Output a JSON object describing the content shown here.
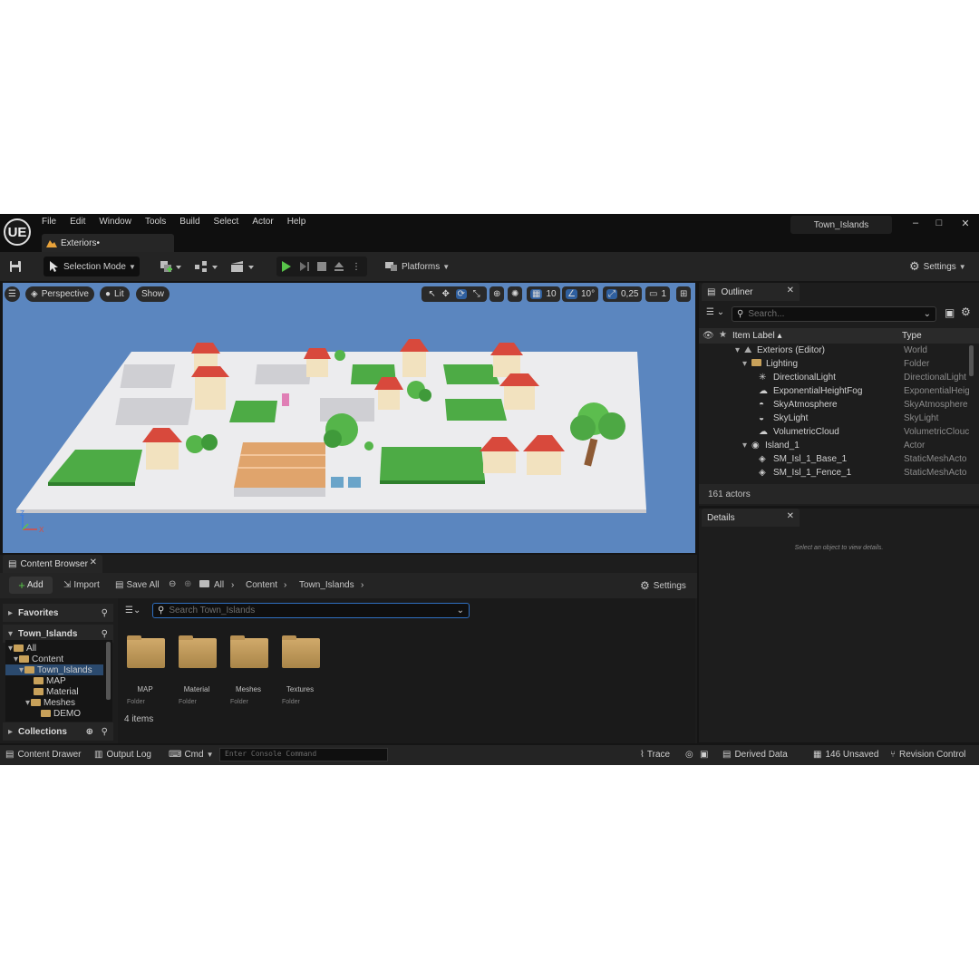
{
  "app": {
    "logo": "UE",
    "menu": [
      "File",
      "Edit",
      "Window",
      "Tools",
      "Build",
      "Select",
      "Actor",
      "Help"
    ],
    "project_name": "Town_Islands",
    "document_tab": "Exteriors•",
    "window_controls": [
      "–",
      "□",
      "✕"
    ]
  },
  "toolbar": {
    "mode_label": "Selection Mode",
    "platforms_label": "Platforms",
    "settings_label": "Settings"
  },
  "viewport": {
    "perspective_label": "Perspective",
    "lit_label": "Lit",
    "show_label": "Show",
    "grid_snap": "10",
    "rotation_snap": "10°",
    "scale_snap": "0,25",
    "camera_speed": "1",
    "sky_color": "#5b86bf",
    "ground_color": "#ececee",
    "axis_labels": {
      "z": "Z",
      "x": "X"
    }
  },
  "outliner": {
    "tab_label": "Outliner",
    "search_placeholder": "Search...",
    "columns": {
      "label": "Item Label ▴",
      "type": "Type"
    },
    "rows": [
      {
        "label": "Exteriors (Editor)",
        "type": "World",
        "icon": "world-icon"
      },
      {
        "label": "Lighting",
        "type": "Folder",
        "icon": "folder-icon"
      },
      {
        "label": "DirectionalLight",
        "type": "DirectionalLight",
        "icon": "sun-icon"
      },
      {
        "label": "ExponentialHeightFog",
        "type": "ExponentialHeig",
        "icon": "fog-icon"
      },
      {
        "label": "SkyAtmosphere",
        "type": "SkyAtmosphere",
        "icon": "atmosphere-icon"
      },
      {
        "label": "SkyLight",
        "type": "SkyLight",
        "icon": "skylight-icon"
      },
      {
        "label": "VolumetricCloud",
        "type": "VolumetricClouc",
        "icon": "cloud-icon"
      },
      {
        "label": "Island_1",
        "type": "Actor",
        "icon": "actor-icon"
      },
      {
        "label": "SM_Isl_1_Base_1",
        "type": "StaticMeshActo",
        "icon": "mesh-icon"
      },
      {
        "label": "SM_Isl_1_Fence_1",
        "type": "StaticMeshActo",
        "icon": "mesh-icon"
      }
    ],
    "actor_count": "161 actors"
  },
  "details": {
    "tab_label": "Details",
    "empty_hint": "Select an object to view details."
  },
  "content_browser": {
    "tab_label": "Content Browser",
    "add_label": "Add",
    "import_label": "Import",
    "save_all_label": "Save All",
    "breadcrumb": [
      "All",
      "Content",
      "Town_Islands"
    ],
    "settings_label": "Settings",
    "favorites_label": "Favorites",
    "town_islands_label": "Town_Islands",
    "collections_label": "Collections",
    "search_placeholder": "Search Town_Islands",
    "folder_tree": [
      "All",
      "Content",
      "Town_Islands",
      "MAP",
      "Material",
      "Meshes",
      "DEMO"
    ],
    "assets": [
      {
        "name": "MAP",
        "type": "Folder"
      },
      {
        "name": "Material",
        "type": "Folder"
      },
      {
        "name": "Meshes",
        "type": "Folder"
      },
      {
        "name": "Textures",
        "type": "Folder"
      }
    ],
    "item_count": "4 items"
  },
  "statusbar": {
    "content_drawer": "Content Drawer",
    "output_log": "Output Log",
    "cmd": "Cmd",
    "console_placeholder": "Enter Console Command",
    "trace": "Trace",
    "derived_data": "Derived Data",
    "unsaved": "146 Unsaved",
    "revision_control": "Revision Control"
  }
}
